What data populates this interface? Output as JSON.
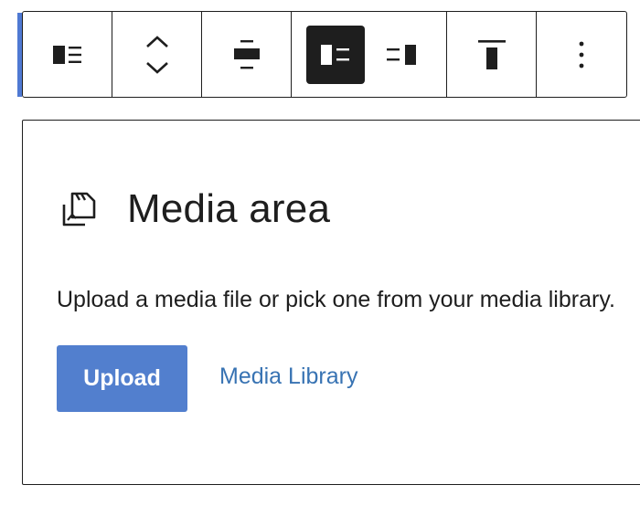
{
  "toolbar": {
    "buttons": [
      {
        "icon": "media-text-icon",
        "label": "Change block type"
      },
      {
        "icon": "move-up-down-icon",
        "label": "Move block"
      },
      {
        "icon": "align-center-icon",
        "label": "Align"
      },
      {
        "icon": "media-left-icon",
        "label": "Show media on left",
        "active": true
      },
      {
        "icon": "media-right-icon",
        "label": "Show media on right"
      },
      {
        "icon": "vertical-align-top-icon",
        "label": "Change vertical alignment"
      },
      {
        "icon": "more-options-icon",
        "label": "Options"
      }
    ]
  },
  "media": {
    "title": "Media area",
    "description": "Upload a media file or pick one from your media library.",
    "upload_label": "Upload",
    "library_label": "Media Library"
  },
  "colors": {
    "accent": "#4f79d3",
    "upload_button": "#527fce",
    "link": "#3873b3",
    "text": "#1e1e1e"
  }
}
